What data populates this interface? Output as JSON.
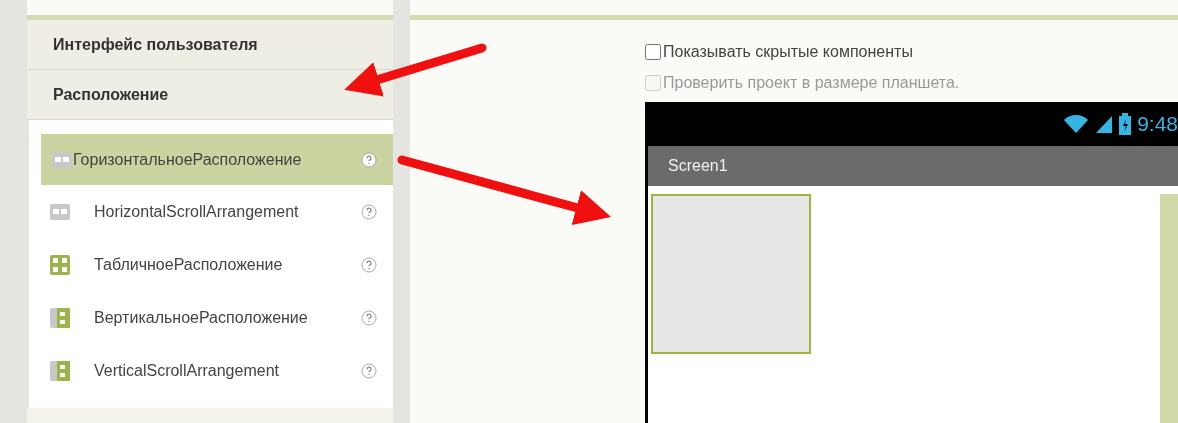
{
  "palette": {
    "sections": [
      {
        "title": "Интерфейс пользователя"
      },
      {
        "title": "Расположение"
      }
    ],
    "items": [
      {
        "label": "ГоризонтальноеРасположение",
        "kind": "horizontal",
        "selected": true
      },
      {
        "label": "HorizontalScrollArrangement",
        "kind": "horizontal",
        "selected": false
      },
      {
        "label": "ТабличноеРасположение",
        "kind": "table",
        "selected": false
      },
      {
        "label": "ВертикальноеРасположение",
        "kind": "vertical",
        "selected": false
      },
      {
        "label": "VerticalScrollArrangement",
        "kind": "vertical",
        "selected": false
      }
    ]
  },
  "viewer": {
    "checkboxes": [
      {
        "label": "Показывать скрытые компоненты",
        "checked": false,
        "disabled": false
      },
      {
        "label": "Проверить проект в размере планшета.",
        "checked": false,
        "disabled": true
      }
    ],
    "phone": {
      "time": "9:48",
      "screen_title": "Screen1"
    }
  }
}
